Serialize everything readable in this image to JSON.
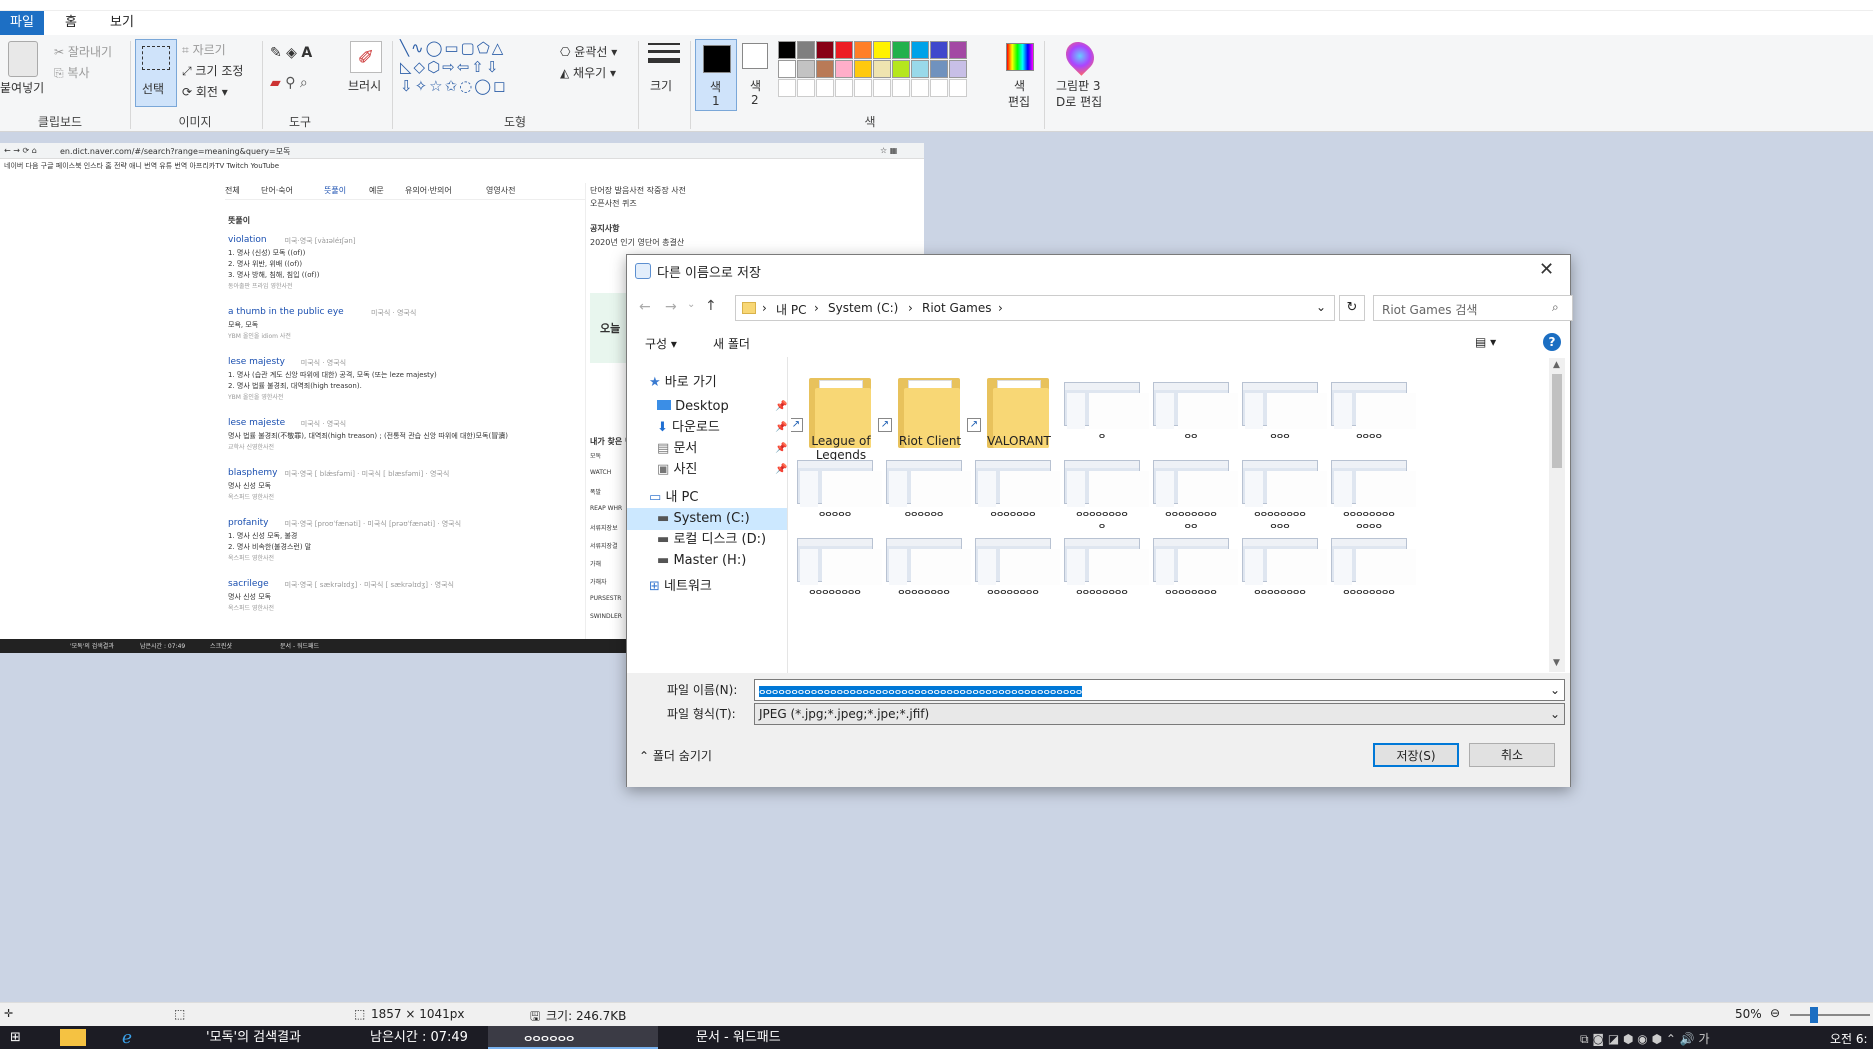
{
  "menu": {
    "file": "파일",
    "home": "홈",
    "view": "보기"
  },
  "ribbon": {
    "paste": "붙여넣기",
    "cut": "잘라내기",
    "copy": "복사",
    "clipboard": "클립보드",
    "select": "선택",
    "crop": "자르기",
    "resize": "크기 조정",
    "rotate": "회전",
    "image": "이미지",
    "tools": "도구",
    "brushes": "브러시",
    "outline": "윤곽선",
    "fill": "채우기",
    "shapes": "도형",
    "size": "크기",
    "color1": "색\n1",
    "color1_a": "색",
    "color1_b": "1",
    "color2_a": "색",
    "color2_b": "2",
    "edit_colors_a": "색",
    "edit_colors_b": "편집",
    "colors": "색",
    "paint3d_a": "그림판 3",
    "paint3d_b": "D로 편집"
  },
  "palette_row1": [
    "#000000",
    "#7f7f7f",
    "#880015",
    "#ed1c24",
    "#ff7f27",
    "#fff200",
    "#22b14c",
    "#00a2e8",
    "#3f48cc",
    "#a349a4"
  ],
  "palette_row2": [
    "#ffffff",
    "#c3c3c3",
    "#b97a57",
    "#ffaec9",
    "#ffc90e",
    "#efe4b0",
    "#b5e61d",
    "#99d9ea",
    "#7092be",
    "#c8bfe7"
  ],
  "embedded": {
    "url": "en.dict.naver.com/#/search?range=meaning&query=모독",
    "bookmarks": [
      "네이버",
      "다음",
      "구글",
      "페이스북",
      "인스타",
      "홈 전략",
      "애니 번역",
      "유튜 번역",
      "아프리카TV",
      "Twitch",
      "YouTube"
    ],
    "tabs": [
      "전체",
      "단어·숙어",
      "뜻풀이",
      "예문",
      "유의어·반의어",
      "영영사전"
    ],
    "section": "뜻풀이",
    "entries": [
      {
        "word": "violation",
        "pron": "미국·영국 [vàɪəléɪʃən]",
        "lines": [
          "1. 명사 (신성) 모독 ((of))",
          "2. 명사 위반, 위배 ((of))",
          "3. 명사 방해, 침해, 침입 ((of))"
        ],
        "src": "동아출판 프라임 영한사전"
      },
      {
        "word": "a thumb in the public eye",
        "pron": "미국식 · 영국식",
        "lines": [
          "모욕, 모독"
        ],
        "src": "YBM 올인올 idiom 사전"
      },
      {
        "word": "lese majesty",
        "pron": "미국식 · 영국식",
        "lines": [
          "1. 명사 (습관 계도 신앙 따위에 대한) 공격, 모독 (또는 leze majesty)",
          "2. 명사 법률 불경죄, 대역죄(high treason)."
        ],
        "src": "YBM 올인올 영한사전"
      },
      {
        "word": "lese majeste",
        "pron": "미국식 · 영국식",
        "lines": [
          "명사 법률 불경죄(不敬罪), 대역죄(high treason) ; (전통적 관습 신앙 따위에 대한)모독(冒瀆)"
        ],
        "src": "교학사 신영한사전"
      },
      {
        "word": "blasphemy",
        "pron": "미국·영국 [ blǽsfəmi] · 미국식 [ blæsfəmi] · 영국식",
        "lines": [
          "명사 신성 모독"
        ],
        "src": "옥스퍼드 영한사전"
      },
      {
        "word": "profanity",
        "pron": "미국·영국 [proʊˈfænəti] · 미국식 [prəʊˈfænəti] · 영국식",
        "lines": [
          "1. 명사 신성 모독, 불경",
          "2. 명사 비속한(불경스런) 말"
        ],
        "src": "옥스퍼드 영한사전"
      },
      {
        "word": "sacrilege",
        "pron": "미국·영국 [ sækrəlɪdʒ] · 미국식 [ sækrəlɪdʒ] · 영국식",
        "lines": [
          "명사 신성 모독"
        ],
        "src": "옥스퍼드 영한사전"
      }
    ],
    "right_links": [
      "단어장",
      "발음사전",
      "작중장 사전",
      "오픈사전",
      "퀴즈"
    ],
    "notice_title": "공지사항",
    "notice_text": "2020년 인기 영단어 총결산",
    "promo": "오늘",
    "history_title": "내가 찾은 단어",
    "history": [
      "모독",
      "WATCH",
      "폭발",
      "REAP WHR",
      "서류지장보",
      "서류지장결",
      "가해",
      "가해자",
      "PURSESTR",
      "SWINDLER"
    ],
    "taskbar": [
      "'모독'의 검색결과",
      "남은시간 : 07:49",
      "스크린샷",
      "문서 - 워드패드"
    ]
  },
  "dialog": {
    "title": "다른 이름으로 저장",
    "breadcrumb": [
      "내 PC",
      "System (C:)",
      "Riot Games"
    ],
    "search_placeholder": "Riot Games 검색",
    "organize": "구성",
    "new_folder": "새 폴더",
    "nav": {
      "quick_access": "바로 가기",
      "desktop": "Desktop",
      "downloads": "다운로드",
      "documents": "문서",
      "pictures": "사진",
      "this_pc": "내 PC",
      "system_c": "System (C:)",
      "local_d": "로컬 디스크 (D:)",
      "master_h": "Master (H:)",
      "network": "네트워크"
    },
    "folders": [
      "League of\nLegends",
      "Riot Client",
      "VALORANT"
    ],
    "folder_lines": [
      [
        "League of",
        "Legends"
      ],
      [
        "Riot Client"
      ],
      [
        "VALORANT"
      ]
    ],
    "files": [
      "ⴰ",
      "ⴰⴰ",
      "ⴰⴰⴰ",
      "ⴰⴰⴰⴰ",
      "ⴰⴰⴰⴰⴰ",
      "ⴰⴰⴰⴰⴰⴰ",
      "ⴰⴰⴰⴰⴰⴰⴰ",
      "ⴰⴰⴰⴰⴰⴰⴰⴰ ⴰ",
      "ⴰⴰⴰⴰⴰⴰⴰⴰ ⴰⴰ",
      "ⴰⴰⴰⴰⴰⴰⴰⴰ ⴰⴰⴰ",
      "ⴰⴰⴰⴰⴰⴰⴰⴰ ⴰⴰⴰⴰ",
      "ⴰⴰⴰⴰⴰⴰⴰⴰ",
      "ⴰⴰⴰⴰⴰⴰⴰⴰ",
      "ⴰⴰⴰⴰⴰⴰⴰⴰ",
      "ⴰⴰⴰⴰⴰⴰⴰⴰ",
      "ⴰⴰⴰⴰⴰⴰⴰⴰ",
      "ⴰⴰⴰⴰⴰⴰⴰⴰ",
      "ⴰⴰⴰⴰⴰⴰⴰⴰ"
    ],
    "filename_label": "파일 이름(N):",
    "filename_value": "ⴰⴰⴰⴰⴰⴰⴰⴰⴰⴰⴰⴰⴰⴰⴰⴰⴰⴰⴰⴰⴰⴰⴰⴰⴰⴰⴰⴰⴰⴰⴰⴰⴰⴰⴰⴰⴰⴰⴰⴰⴰⴰⴰⴰⴰⴰⴰⴰⴰⴰ",
    "filetype_label": "파일 형식(T):",
    "filetype_value": "JPEG (*.jpg;*.jpeg;*.jpe;*.jfif)",
    "hide_folders": "폴더 숨기기",
    "save": "저장(S)",
    "cancel": "취소"
  },
  "status": {
    "dimensions": "1857 × 1041px",
    "size": "크기: 246.7KB",
    "zoom": "50%"
  },
  "taskbar": {
    "items": [
      "'모독'의 검색결과",
      "남은시간 : 07:49",
      "ⴰⴰⴰⴰⴰⴰ",
      "문서 - 워드패드"
    ],
    "clock": "오전 6:"
  }
}
